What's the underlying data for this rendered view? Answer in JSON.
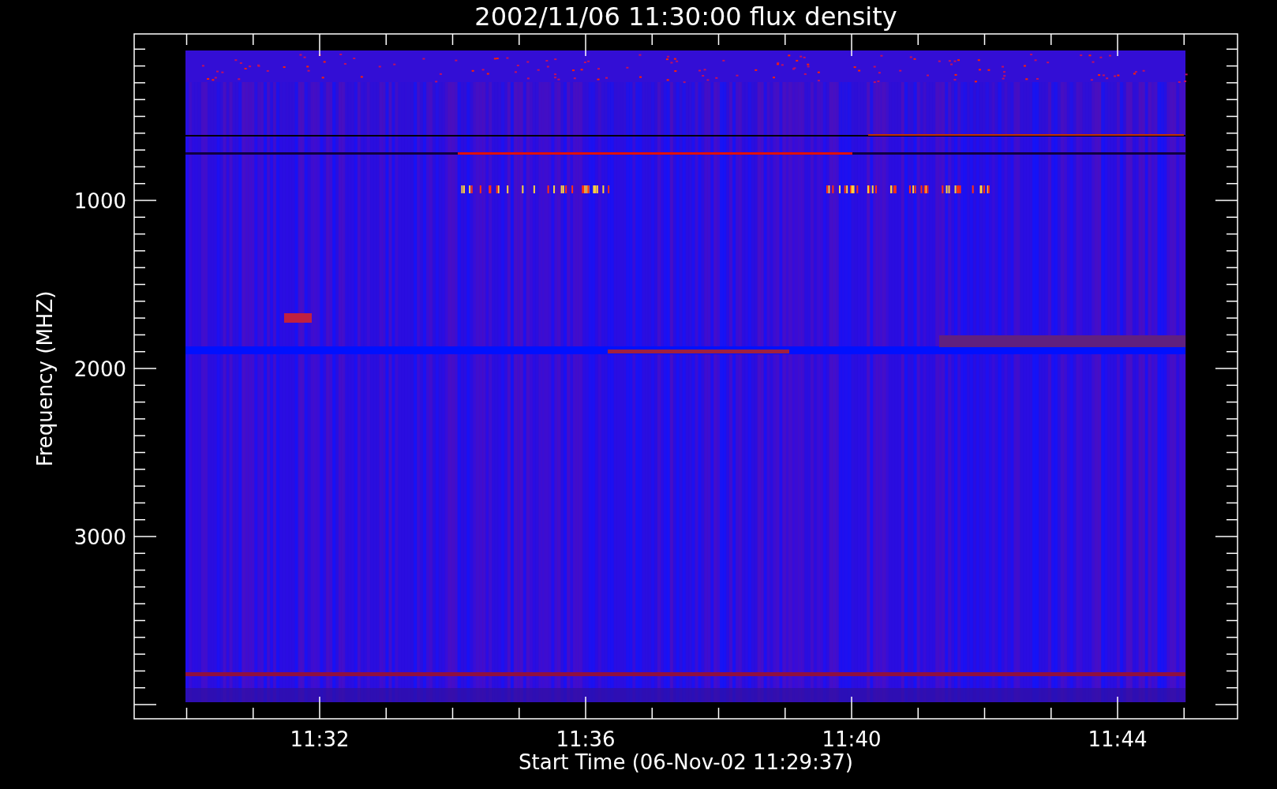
{
  "plot": {
    "title": "2002/11/06 11:30:00 flux density",
    "ylabel": "Frequency (MHZ)",
    "xlabel": "Start Time (06-Nov-02 11:29:37)",
    "yticks": [
      "1000",
      "2000",
      "3000"
    ],
    "xticks": [
      "11:32",
      "11:36",
      "11:40",
      "11:44"
    ]
  }
}
